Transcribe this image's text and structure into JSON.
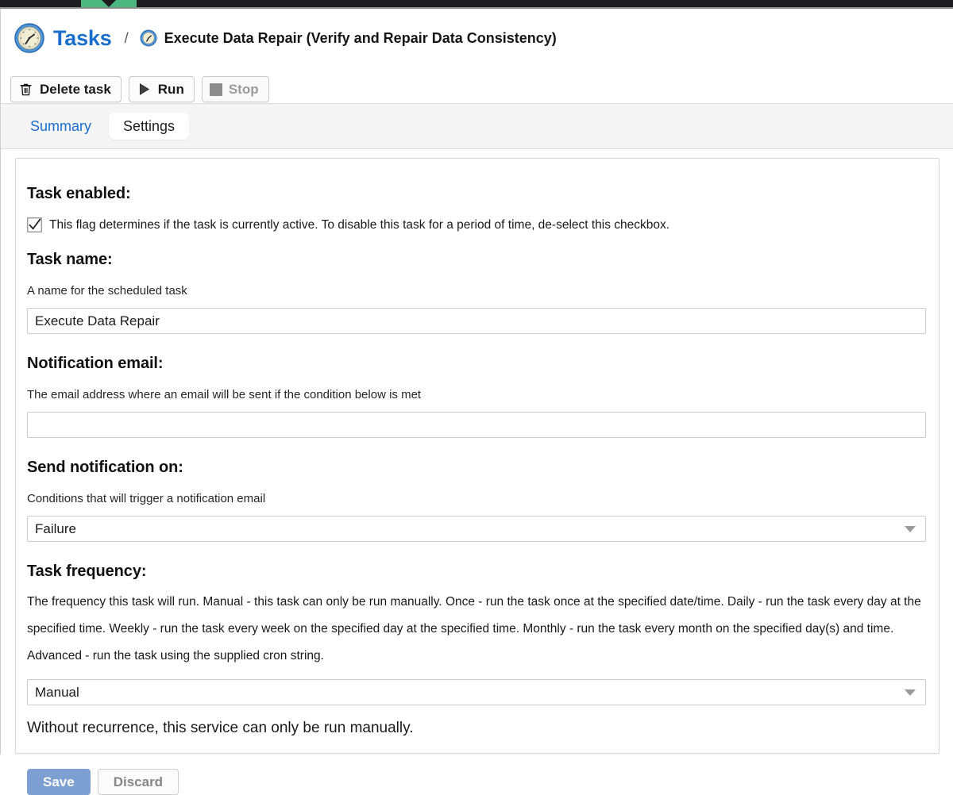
{
  "window": {
    "top_tab_color": "#4cb780",
    "top_bar_color": "#1d1d1f"
  },
  "breadcrumb": {
    "root_icon": "clock-icon",
    "root_label": "Tasks",
    "separator": "/",
    "current_icon": "clock-icon",
    "current_label": "Execute Data Repair (Verify and Repair Data Consistency)",
    "link_color": "#1a6ecc"
  },
  "toolbar": {
    "buttons": [
      {
        "name": "delete-task",
        "label": "Delete task",
        "icon": "trash-icon",
        "disabled": false
      },
      {
        "name": "run",
        "label": "Run",
        "icon": "play-icon",
        "disabled": false
      },
      {
        "name": "stop",
        "label": "Stop",
        "icon": "stop-square-icon",
        "disabled": true
      }
    ]
  },
  "tabs": [
    {
      "label": "Summary",
      "active": false
    },
    {
      "label": "Settings",
      "active": true
    }
  ],
  "form": {
    "task_enabled": {
      "heading": "Task enabled:",
      "checkbox_checked": true,
      "description": "This flag determines if the task is currently active. To disable this task for a period of time, de-select this checkbox."
    },
    "task_name": {
      "heading": "Task name:",
      "hint": "A name for the scheduled task",
      "value": "Execute Data Repair",
      "placeholder": ""
    },
    "notification_email": {
      "heading": "Notification email:",
      "hint": "The email address where an email will be sent if the condition below is met",
      "value": "",
      "placeholder": ""
    },
    "send_notification_on": {
      "heading": "Send notification on:",
      "hint": "Conditions that will trigger a notification email",
      "selected": "Failure"
    },
    "task_frequency": {
      "heading": "Task frequency:",
      "description": "The frequency this task will run. Manual - this task can only be run manually. Once - run the task once at the specified date/time. Daily - run the task every day at the specified time. Weekly - run the task every week on the specified day at the specified time. Monthly - run the task every month on the specified day(s) and time. Advanced - run the task using the supplied cron string.",
      "selected": "Manual",
      "note": "Without recurrence, this service can only be run manually."
    }
  },
  "actions": {
    "save_label": "Save",
    "discard_label": "Discard",
    "save_color": "#7d9fd1"
  }
}
